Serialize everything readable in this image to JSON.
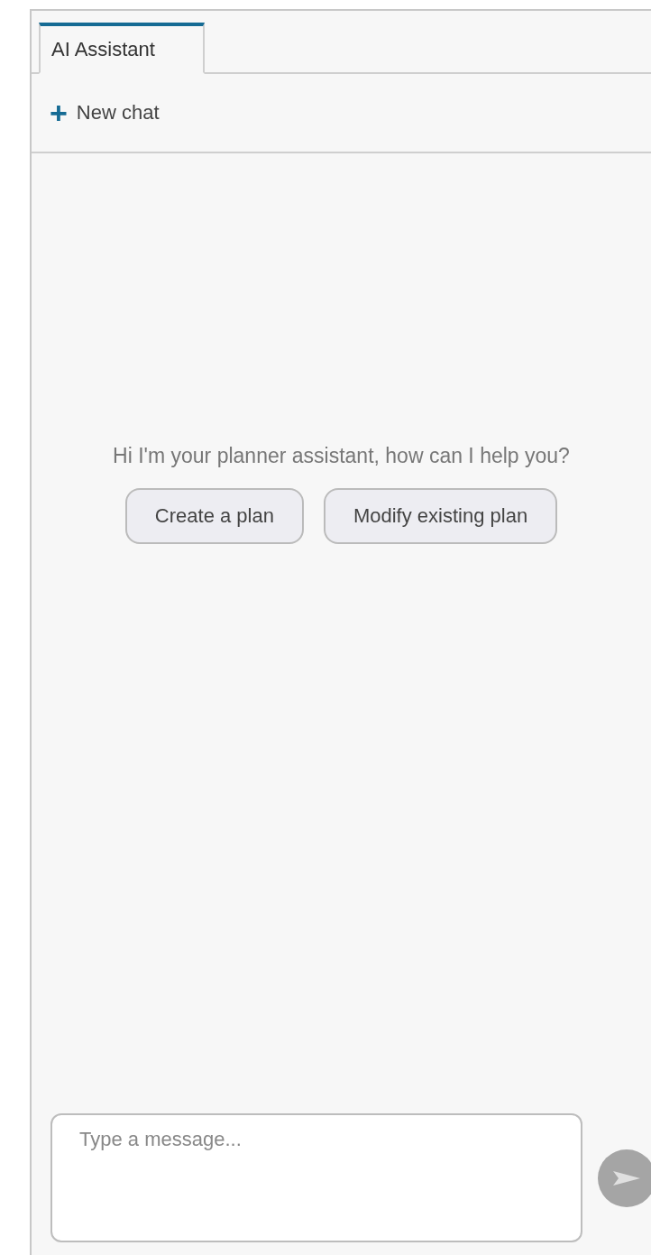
{
  "tabs": [
    {
      "label": "AI Assistant",
      "selected": true
    }
  ],
  "new_chat": {
    "icon": "+",
    "label": "New chat"
  },
  "greeting": "Hi I'm your planner assistant, how can I help you?",
  "suggestions": [
    "Create a plan",
    "Modify existing plan"
  ],
  "composer": {
    "placeholder": "Type a message...",
    "send_disabled": true
  }
}
